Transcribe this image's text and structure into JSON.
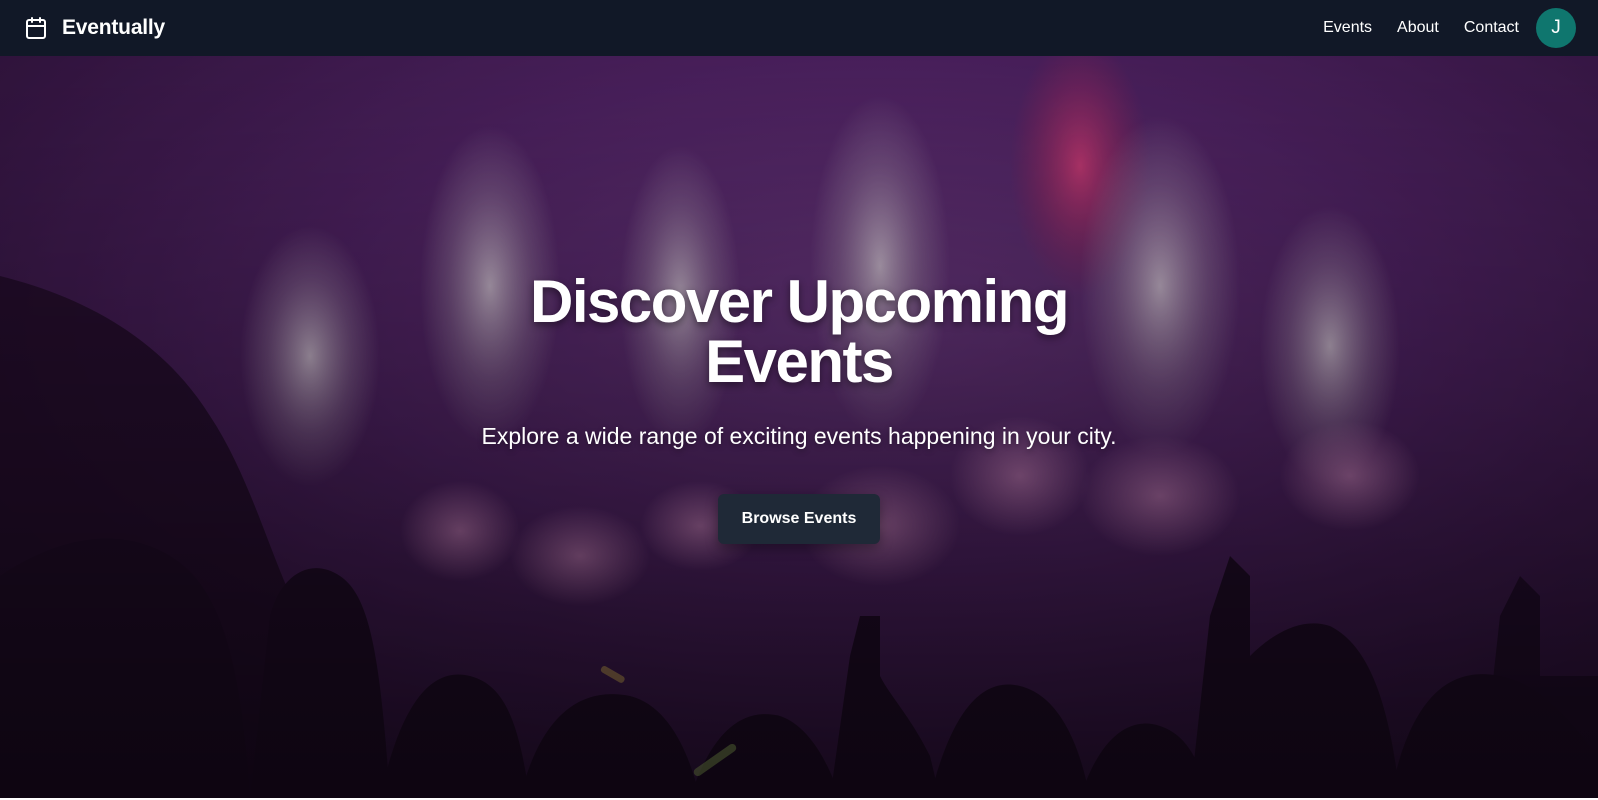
{
  "navbar": {
    "brand_icon": "calendar-icon",
    "brand_name": "Eventually",
    "links": [
      "Events",
      "About",
      "Contact"
    ],
    "avatar_initial": "J",
    "avatar_color": "#0f766e",
    "background": "#111827"
  },
  "hero": {
    "title": "Discover Upcoming Events",
    "subtitle": "Explore a wide range of exciting events happening in your city.",
    "cta_label": "Browse Events",
    "cta_color": "#1f2937",
    "overlay_tint": "#4a1d5e"
  }
}
